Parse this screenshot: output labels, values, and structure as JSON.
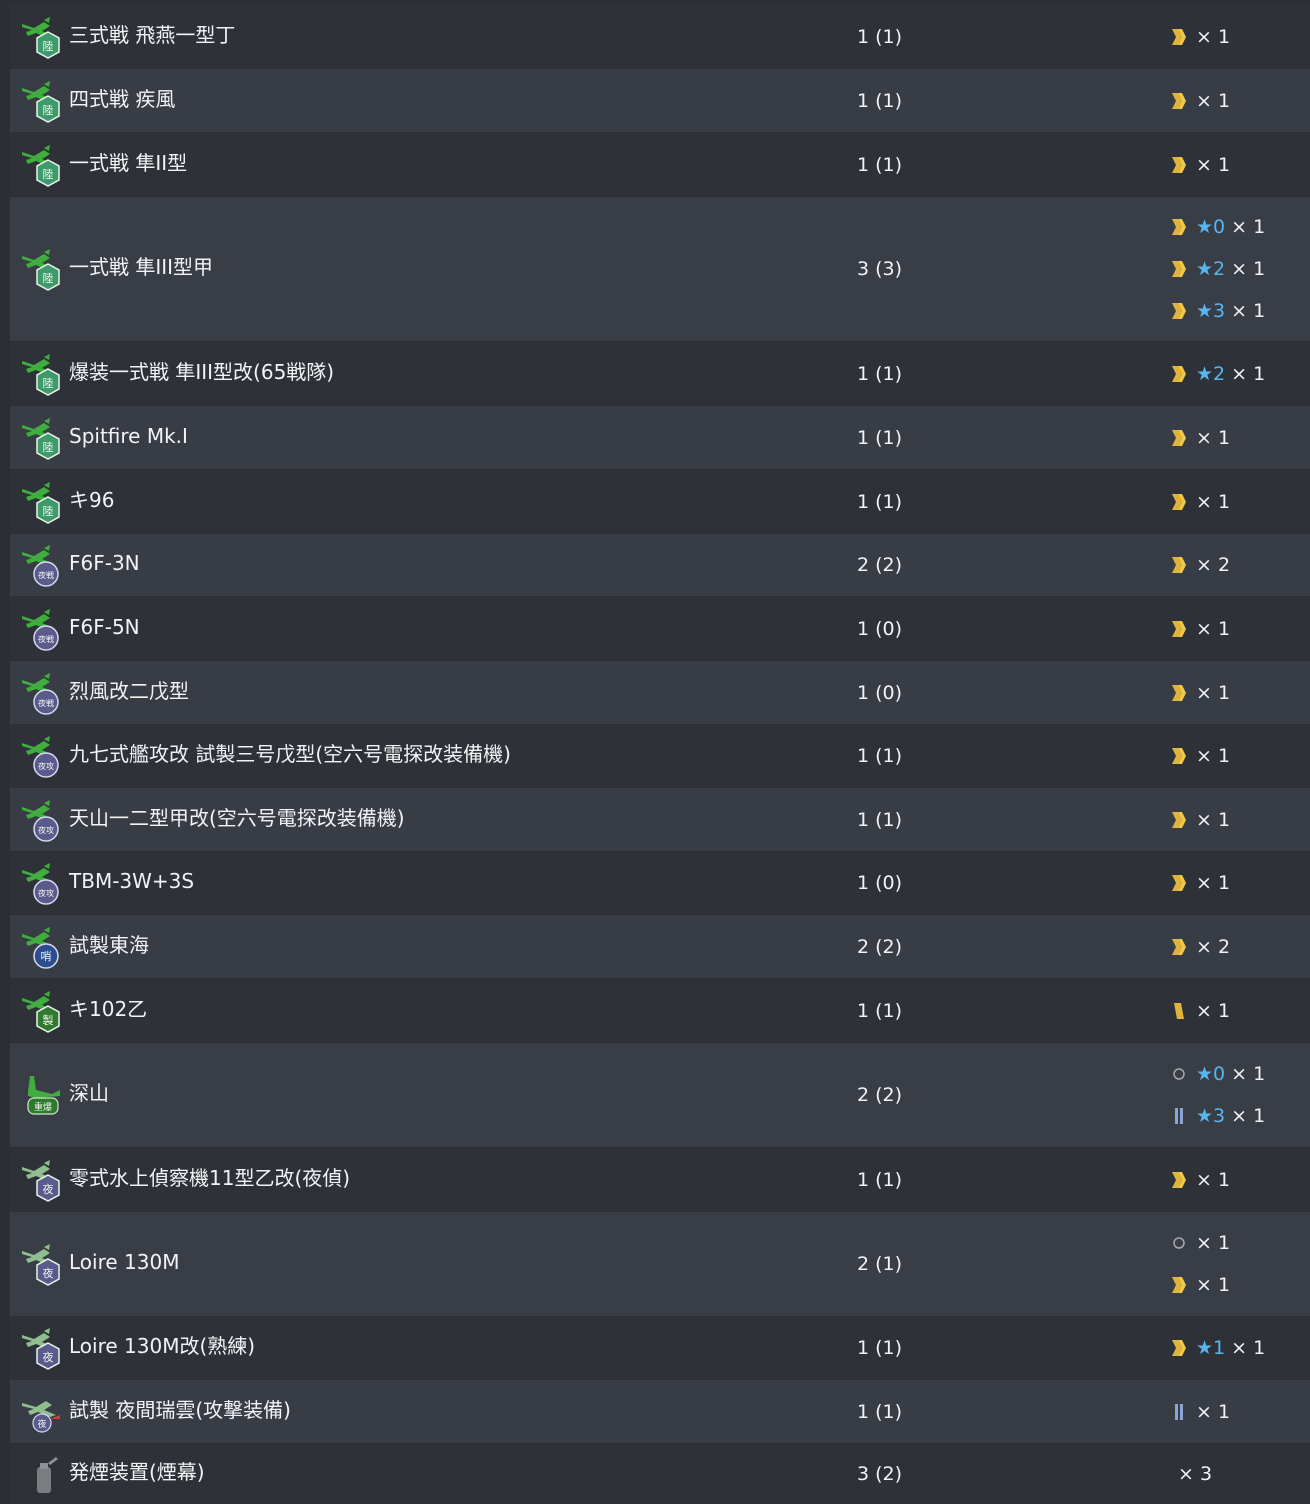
{
  "colors": {
    "accent_gold": "#e0b43c",
    "star_blue": "#56b6f0",
    "row_dark": "#2e3238",
    "row_light": "#383c44"
  },
  "rows": [
    {
      "name": "三式戦 飛燕一型丁",
      "count": "1 (1)",
      "icon": "army-fighter-icon",
      "prof": [
        {
          "icon": "chevron-proficiency-icon",
          "star": "",
          "mult": "× 1"
        }
      ]
    },
    {
      "name": "四式戦 疾風",
      "count": "1 (1)",
      "icon": "army-fighter-icon",
      "prof": [
        {
          "icon": "chevron-proficiency-icon",
          "star": "",
          "mult": "× 1"
        }
      ]
    },
    {
      "name": "一式戦 隼II型",
      "count": "1 (1)",
      "icon": "army-fighter-icon",
      "prof": [
        {
          "icon": "chevron-proficiency-icon",
          "star": "",
          "mult": "× 1"
        }
      ]
    },
    {
      "name": "一式戦 隼III型甲",
      "count": "3 (3)",
      "icon": "army-fighter-icon",
      "prof": [
        {
          "icon": "chevron-proficiency-icon",
          "star": "★0",
          "mult": "× 1"
        },
        {
          "icon": "chevron-proficiency-icon",
          "star": "★2",
          "mult": "× 1"
        },
        {
          "icon": "chevron-proficiency-icon",
          "star": "★3",
          "mult": "× 1"
        }
      ]
    },
    {
      "name": "爆装一式戦 隼III型改(65戦隊)",
      "count": "1 (1)",
      "icon": "army-fighter-icon",
      "prof": [
        {
          "icon": "chevron-proficiency-icon",
          "star": "★2",
          "mult": "× 1"
        }
      ]
    },
    {
      "name": "Spitfire Mk.I",
      "count": "1 (1)",
      "icon": "army-fighter-icon",
      "prof": [
        {
          "icon": "chevron-proficiency-icon",
          "star": "",
          "mult": "× 1"
        }
      ]
    },
    {
      "name": "キ96",
      "count": "1 (1)",
      "icon": "army-fighter-icon",
      "prof": [
        {
          "icon": "chevron-proficiency-icon",
          "star": "",
          "mult": "× 1"
        }
      ]
    },
    {
      "name": "F6F-3N",
      "count": "2 (2)",
      "icon": "night-fighter-icon",
      "prof": [
        {
          "icon": "chevron-proficiency-icon",
          "star": "",
          "mult": "× 2"
        }
      ]
    },
    {
      "name": "F6F-5N",
      "count": "1 (0)",
      "icon": "night-fighter-icon",
      "prof": [
        {
          "icon": "chevron-proficiency-icon",
          "star": "",
          "mult": "× 1"
        }
      ]
    },
    {
      "name": "烈風改二戊型",
      "count": "1 (0)",
      "icon": "night-fighter-icon",
      "prof": [
        {
          "icon": "chevron-proficiency-icon",
          "star": "",
          "mult": "× 1"
        }
      ]
    },
    {
      "name": "九七式艦攻改 試製三号戊型(空六号電探改装備機)",
      "count": "1 (1)",
      "icon": "night-attacker-icon",
      "prof": [
        {
          "icon": "chevron-proficiency-icon",
          "star": "",
          "mult": "× 1"
        }
      ]
    },
    {
      "name": "天山一二型甲改(空六号電探改装備機)",
      "count": "1 (1)",
      "icon": "night-attacker-icon",
      "prof": [
        {
          "icon": "chevron-proficiency-icon",
          "star": "",
          "mult": "× 1"
        }
      ]
    },
    {
      "name": "TBM-3W+3S",
      "count": "1 (0)",
      "icon": "night-attacker-icon",
      "prof": [
        {
          "icon": "chevron-proficiency-icon",
          "star": "",
          "mult": "× 1"
        }
      ]
    },
    {
      "name": "試製東海",
      "count": "2 (2)",
      "icon": "patrol-plane-icon",
      "prof": [
        {
          "icon": "chevron-proficiency-icon",
          "star": "",
          "mult": "× 2"
        }
      ]
    },
    {
      "name": "キ102乙",
      "count": "1 (1)",
      "icon": "land-bomber-icon",
      "prof": [
        {
          "icon": "bar-proficiency-icon",
          "star": "",
          "mult": "× 1"
        }
      ]
    },
    {
      "name": "深山",
      "count": "2 (2)",
      "icon": "heavy-bomber-icon",
      "prof": [
        {
          "icon": "circle-proficiency-icon",
          "star": "★0",
          "mult": "× 1"
        },
        {
          "icon": "double-bar-proficiency-icon",
          "star": "★3",
          "mult": "× 1"
        }
      ]
    },
    {
      "name": "零式水上偵察機11型乙改(夜偵)",
      "count": "1 (1)",
      "icon": "night-seaplane-icon",
      "prof": [
        {
          "icon": "chevron-proficiency-icon",
          "star": "",
          "mult": "× 1"
        }
      ]
    },
    {
      "name": "Loire 130M",
      "count": "2 (1)",
      "icon": "night-seaplane-icon",
      "prof": [
        {
          "icon": "circle-proficiency-icon",
          "star": "",
          "mult": "× 1"
        },
        {
          "icon": "chevron-proficiency-icon",
          "star": "",
          "mult": "× 1"
        }
      ]
    },
    {
      "name": "Loire 130M改(熟練)",
      "count": "1 (1)",
      "icon": "night-seaplane-icon",
      "prof": [
        {
          "icon": "chevron-proficiency-icon",
          "star": "★1",
          "mult": "× 1"
        }
      ]
    },
    {
      "name": "試製 夜間瑞雲(攻撃装備)",
      "count": "1 (1)",
      "icon": "night-seabomber-icon",
      "prof": [
        {
          "icon": "double-bar-proficiency-icon",
          "star": "",
          "mult": "× 1"
        }
      ]
    },
    {
      "name": "発煙装置(煙幕)",
      "count": "3 (2)",
      "icon": "smoke-generator-icon",
      "prof": [
        {
          "icon": "",
          "star": "",
          "mult": "× 3"
        }
      ]
    }
  ]
}
